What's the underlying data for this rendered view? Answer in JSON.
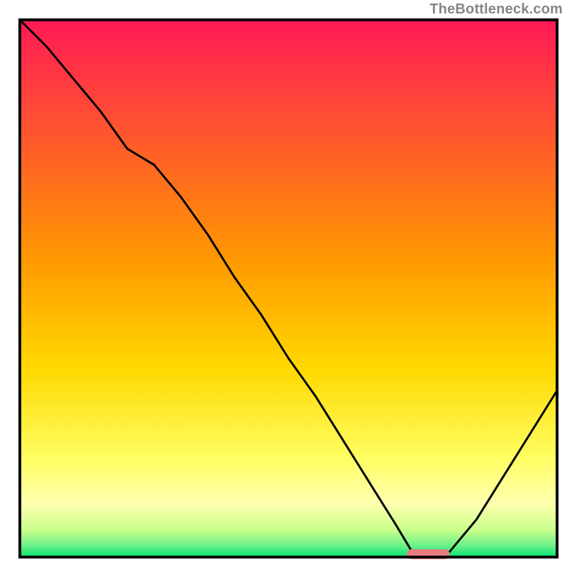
{
  "attribution": "TheBottleneck.com",
  "chart_data": {
    "type": "line",
    "title": "",
    "xlabel": "",
    "ylabel": "",
    "xlim": [
      0,
      100
    ],
    "ylim": [
      0,
      100
    ],
    "x": [
      0,
      5,
      10,
      15,
      20,
      25,
      30,
      35,
      40,
      45,
      50,
      55,
      60,
      65,
      70,
      73,
      77,
      80,
      85,
      90,
      95,
      100
    ],
    "values": [
      100,
      95,
      89,
      83,
      76,
      73,
      67,
      60,
      52,
      45,
      37,
      30,
      22,
      14,
      6,
      1,
      0,
      1,
      7,
      15,
      23,
      31
    ],
    "optimum_marker": {
      "x_start": 72,
      "x_end": 80,
      "y": 0
    },
    "gradient_top": "#ff1956",
    "gradient_mid": "#ffd900",
    "gradient_low": "#ffffa5",
    "gradient_bottom": "#00e46e",
    "frame_color": "#000000"
  }
}
